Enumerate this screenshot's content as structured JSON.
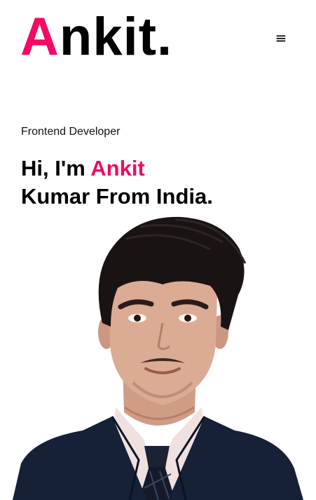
{
  "header": {
    "logo_first_letter": "A",
    "logo_rest": "nkit.",
    "menu_icon": "hamburger-icon",
    "menu_glyph": "≡"
  },
  "hero": {
    "role": "Frontend Developer",
    "greeting_prefix": "Hi, I'm",
    "greeting_name": "Ankit",
    "greeting_line2": "Kumar From India."
  },
  "colors": {
    "accent": "#f20a63",
    "text": "#000000",
    "background": "#ffffff"
  },
  "portrait": {
    "icon": "profile-photo"
  }
}
